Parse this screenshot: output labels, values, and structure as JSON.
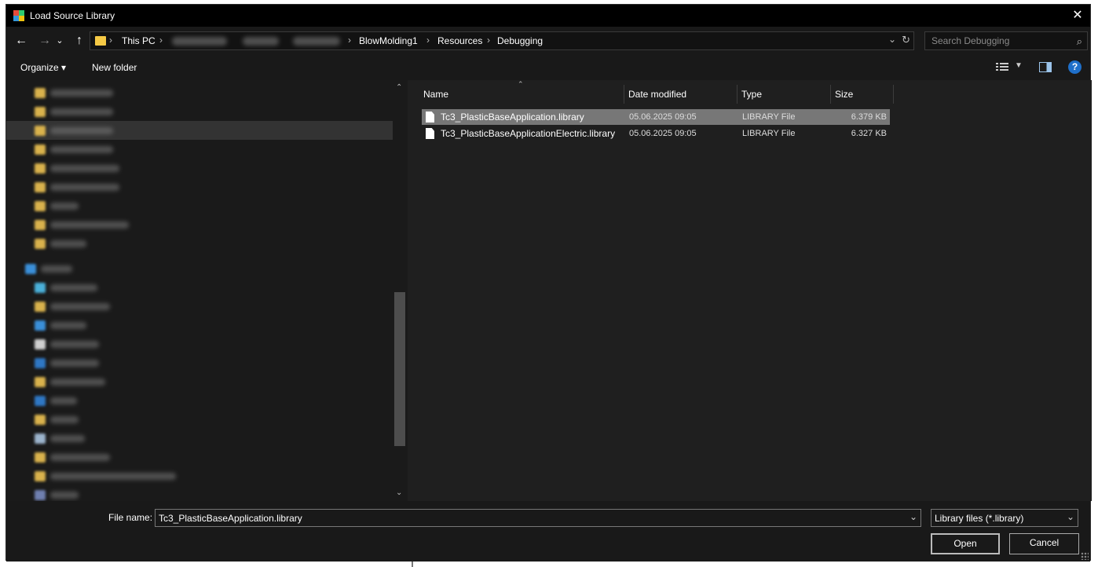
{
  "window": {
    "title": "Load Source Library",
    "close_glyph": "✕"
  },
  "nav": {
    "back_glyph": "←",
    "forward_glyph": "→",
    "recent_glyph": "⌄",
    "up_glyph": "↑"
  },
  "address": {
    "crumbs": [
      "This PC",
      "BlowMolding1",
      "Resources",
      "Debugging"
    ],
    "separator": "›",
    "dropdown_glyph": "⌄",
    "refresh_glyph": "↻"
  },
  "search": {
    "placeholder": "Search Debugging",
    "icon_glyph": "⌕"
  },
  "toolbar": {
    "organize_label": "Organize ▾",
    "new_folder_label": "New folder",
    "view_dd_glyph": "▼",
    "help_glyph": "?"
  },
  "navpane": {
    "up_glyph": "⌃",
    "down_glyph": "⌄"
  },
  "columns": {
    "name": "Name",
    "date": "Date modified",
    "type": "Type",
    "size": "Size",
    "sort_glyph": "⌃"
  },
  "files": [
    {
      "name": "Tc3_PlasticBaseApplication.library",
      "date": "05.06.2025 09:05",
      "type": "LIBRARY File",
      "size": "6.379 KB"
    },
    {
      "name": "Tc3_PlasticBaseApplicationElectric.library",
      "date": "05.06.2025 09:05",
      "type": "LIBRARY File",
      "size": "6.327 KB"
    }
  ],
  "footer": {
    "file_name_label": "File name:",
    "file_name_value": "Tc3_PlasticBaseApplication.library",
    "filter_label": "Library files (*.library)",
    "dropdown_glyph": "⌄",
    "open_label": "Open",
    "cancel_label": "Cancel"
  },
  "colors": {
    "folder": "#f5c945",
    "accent": "#1f6fc9",
    "selection": "#777777"
  }
}
